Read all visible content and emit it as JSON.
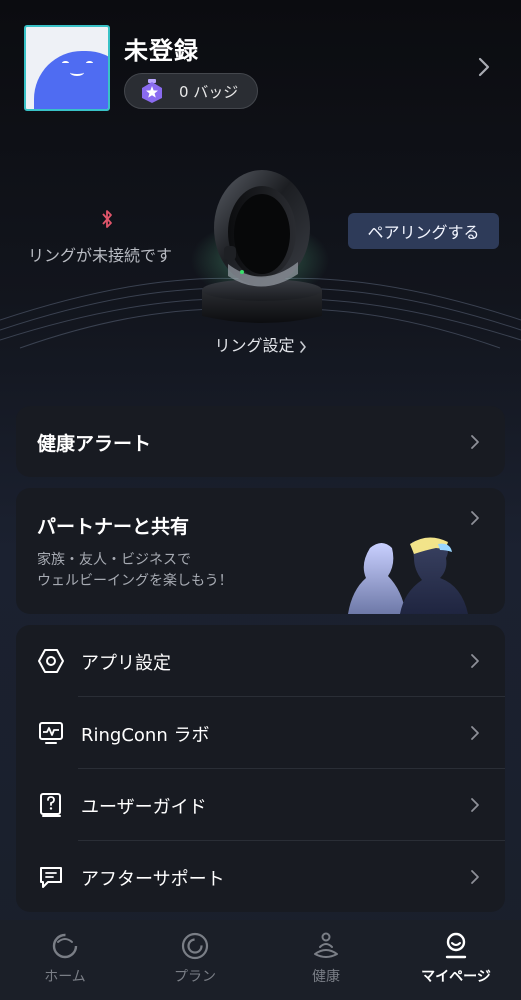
{
  "profile": {
    "name": "未登録",
    "badge_count_label": "0 バッジ"
  },
  "ring": {
    "status": "リングが未接続です",
    "pair_label": "ペアリングする",
    "settings_label": "リング設定"
  },
  "cards": {
    "health_alert": "健康アラート",
    "partner": {
      "title": "パートナーと共有",
      "desc_line1": "家族・友人・ビジネスで",
      "desc_line2": "ウェルビーイングを楽しもう！"
    }
  },
  "settings_list": [
    {
      "label": "アプリ設定",
      "icon": "hexagon-gear-icon"
    },
    {
      "label": "RingConn ラボ",
      "icon": "monitor-pulse-icon"
    },
    {
      "label": "ユーザーガイド",
      "icon": "question-book-icon"
    },
    {
      "label": "アフターサポート",
      "icon": "chat-bubble-icon"
    }
  ],
  "nav": {
    "items": [
      {
        "label": "ホーム",
        "icon": "home-ring-icon"
      },
      {
        "label": "プラン",
        "icon": "plan-ring-icon"
      },
      {
        "label": "健康",
        "icon": "meditation-icon"
      },
      {
        "label": "マイページ",
        "icon": "profile-icon"
      }
    ],
    "active_index": 3
  },
  "colors": {
    "accent_teal": "#39c2c7",
    "avatar_blue": "#4f6cf2",
    "pair_button_bg": "#2e3b59",
    "bluetooth_off": "#e0556a",
    "badge_purple": "#8a6bf0"
  }
}
